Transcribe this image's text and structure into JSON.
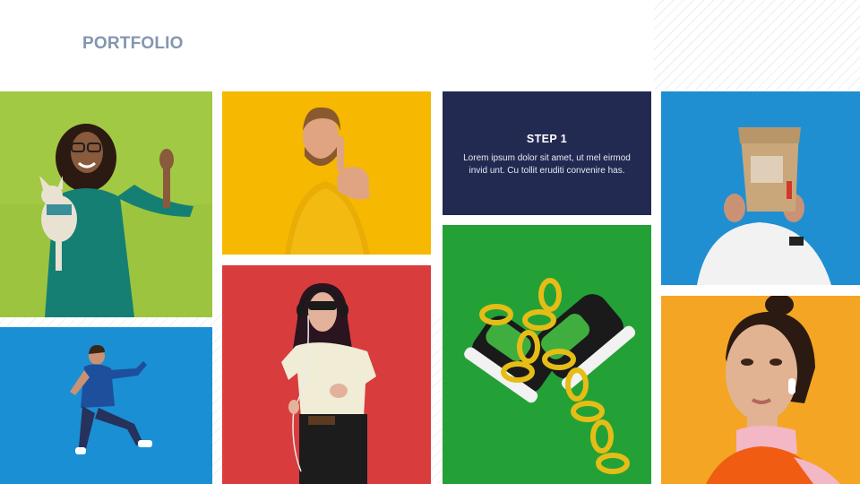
{
  "slide": {
    "title": "PORTFOLIO"
  },
  "step_card": {
    "title": "STEP 1",
    "body": "Lorem ipsum dolor sit amet, ut mel eirmod invid unt. Cu tollit eruditi convenire has."
  },
  "photos": [
    {
      "subject": "woman-holding-dog",
      "background": "#9cc43e"
    },
    {
      "subject": "man-pointing",
      "background": "#f6b800"
    },
    {
      "subject": "man-with-paper-bag",
      "background": "#1f8fd2"
    },
    {
      "subject": "man-jumping",
      "background": "#1b8fd3"
    },
    {
      "subject": "woman-with-headphones",
      "background": "#d93c3d"
    },
    {
      "subject": "sneakers-with-chain",
      "background": "#23a137"
    },
    {
      "subject": "woman-with-earbuds",
      "background": "#f5a524"
    }
  ],
  "colors": {
    "title": "#8496b0",
    "step_card": "#232a52"
  }
}
